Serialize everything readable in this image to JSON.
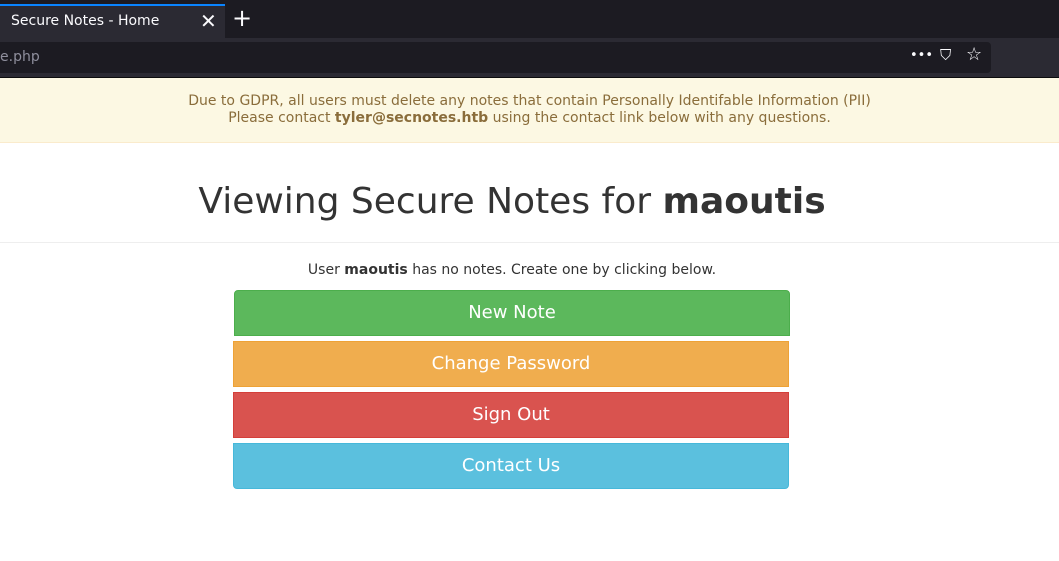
{
  "browser": {
    "tab_title": "Secure Notes - Home",
    "tab_close": "✕",
    "new_tab": "+",
    "url": "e.php",
    "menu_icon": "•••",
    "pocket_icon": "⛉",
    "bookmark_icon": "☆"
  },
  "banner": {
    "line1": "Due to GDPR, all users must delete any notes that contain Personally Identifable Information (PII)",
    "line2_prefix": "Please contact ",
    "email": "tyler@secnotes.htb",
    "line2_suffix": " using the contact link below with any questions."
  },
  "heading": {
    "prefix": "Viewing Secure Notes for ",
    "username": "maoutis"
  },
  "notes_message": {
    "prefix": "User ",
    "username": "maoutis",
    "suffix": " has no notes. Create one by clicking below."
  },
  "buttons": {
    "new_note": "New Note",
    "change_password": "Change Password",
    "sign_out": "Sign Out",
    "contact_us": "Contact Us"
  },
  "colors": {
    "green": "#5cb85c",
    "orange": "#f0ad4e",
    "red": "#d9534f",
    "blue": "#5bc0de",
    "banner_bg": "#fcf8e3"
  }
}
